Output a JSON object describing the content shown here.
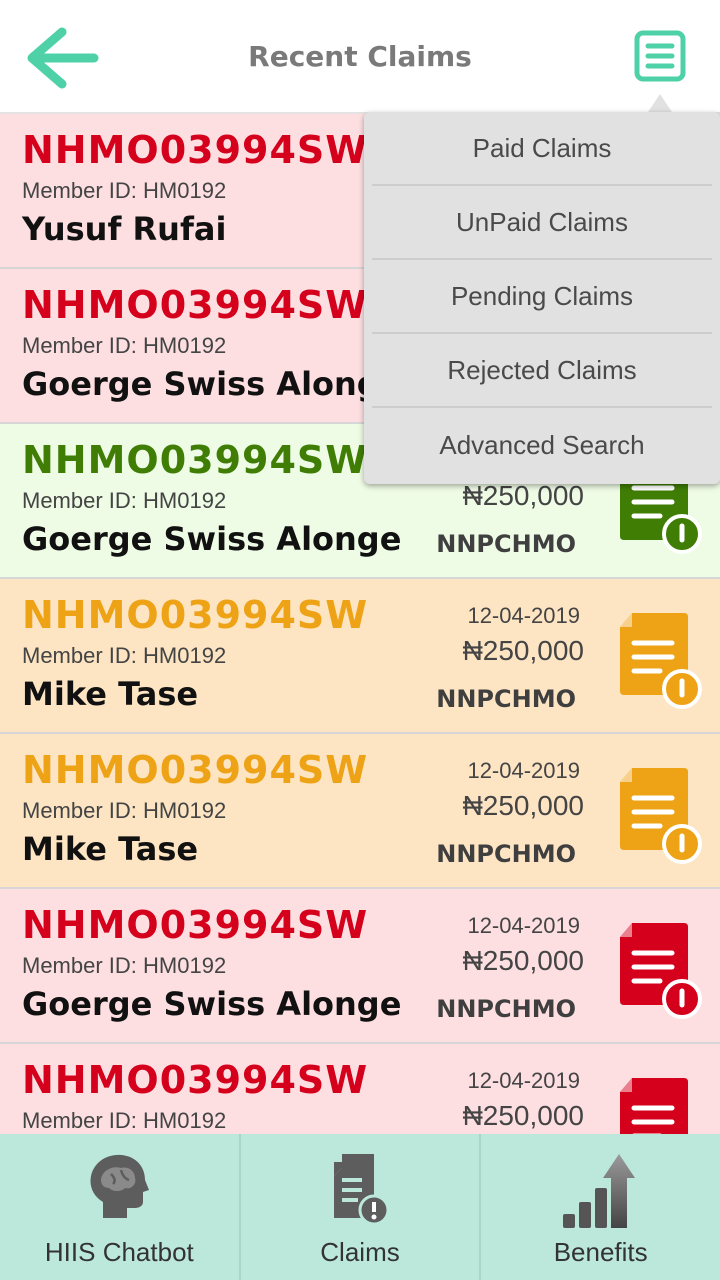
{
  "header": {
    "title": "Recent Claims"
  },
  "colors": {
    "accent": "#4fd1a8",
    "red": "#d4001c",
    "green": "#3f7d05",
    "orange": "#eea316"
  },
  "menu": {
    "items": [
      "Paid Claims",
      "UnPaid Claims",
      "Pending Claims",
      "Rejected Claims",
      "Advanced Search"
    ]
  },
  "claims": [
    {
      "status": "red",
      "code": "NHMO03994SW",
      "member": "Member ID: HM0192",
      "name": "Yusuf Rufai",
      "date": "",
      "amount": "",
      "hmo": "",
      "icon": "document-pending-icon"
    },
    {
      "status": "red",
      "code": "NHMO03994SW",
      "member": "Member ID: HM0192",
      "name": "Goerge Swiss Along",
      "date": "",
      "amount": "",
      "hmo": "",
      "icon": "document-pending-icon"
    },
    {
      "status": "green",
      "code": "NHMO03994SW",
      "member": "Member ID: HM0192",
      "name": "Goerge Swiss Alonge",
      "date": "",
      "amount": "₦250,000",
      "hmo": "NNPCHMO",
      "icon": "document-pending-icon"
    },
    {
      "status": "orange",
      "code": "NHMO03994SW",
      "member": "Member ID: HM0192",
      "name": "Mike Tase",
      "date": "12-04-2019",
      "amount": "₦250,000",
      "hmo": "NNPCHMO",
      "icon": "document-pending-icon"
    },
    {
      "status": "orange",
      "code": "NHMO03994SW",
      "member": "Member ID: HM0192",
      "name": "Mike Tase",
      "date": "12-04-2019",
      "amount": "₦250,000",
      "hmo": "NNPCHMO",
      "icon": "document-pending-icon"
    },
    {
      "status": "red",
      "code": "NHMO03994SW",
      "member": "Member ID: HM0192",
      "name": "Goerge Swiss Alonge",
      "date": "12-04-2019",
      "amount": "₦250,000",
      "hmo": "NNPCHMO",
      "icon": "document-pending-icon"
    },
    {
      "status": "red",
      "code": "NHMO03994SW",
      "member": "Member ID: HM0192",
      "name": "",
      "date": "12-04-2019",
      "amount": "₦250,000",
      "hmo": "",
      "icon": "document-pending-icon"
    }
  ],
  "tabs": [
    {
      "label": "HIIS Chatbot",
      "icon": "brain-head-icon"
    },
    {
      "label": "Claims",
      "icon": "claims-document-icon"
    },
    {
      "label": "Benefits",
      "icon": "bar-chart-up-icon"
    }
  ]
}
